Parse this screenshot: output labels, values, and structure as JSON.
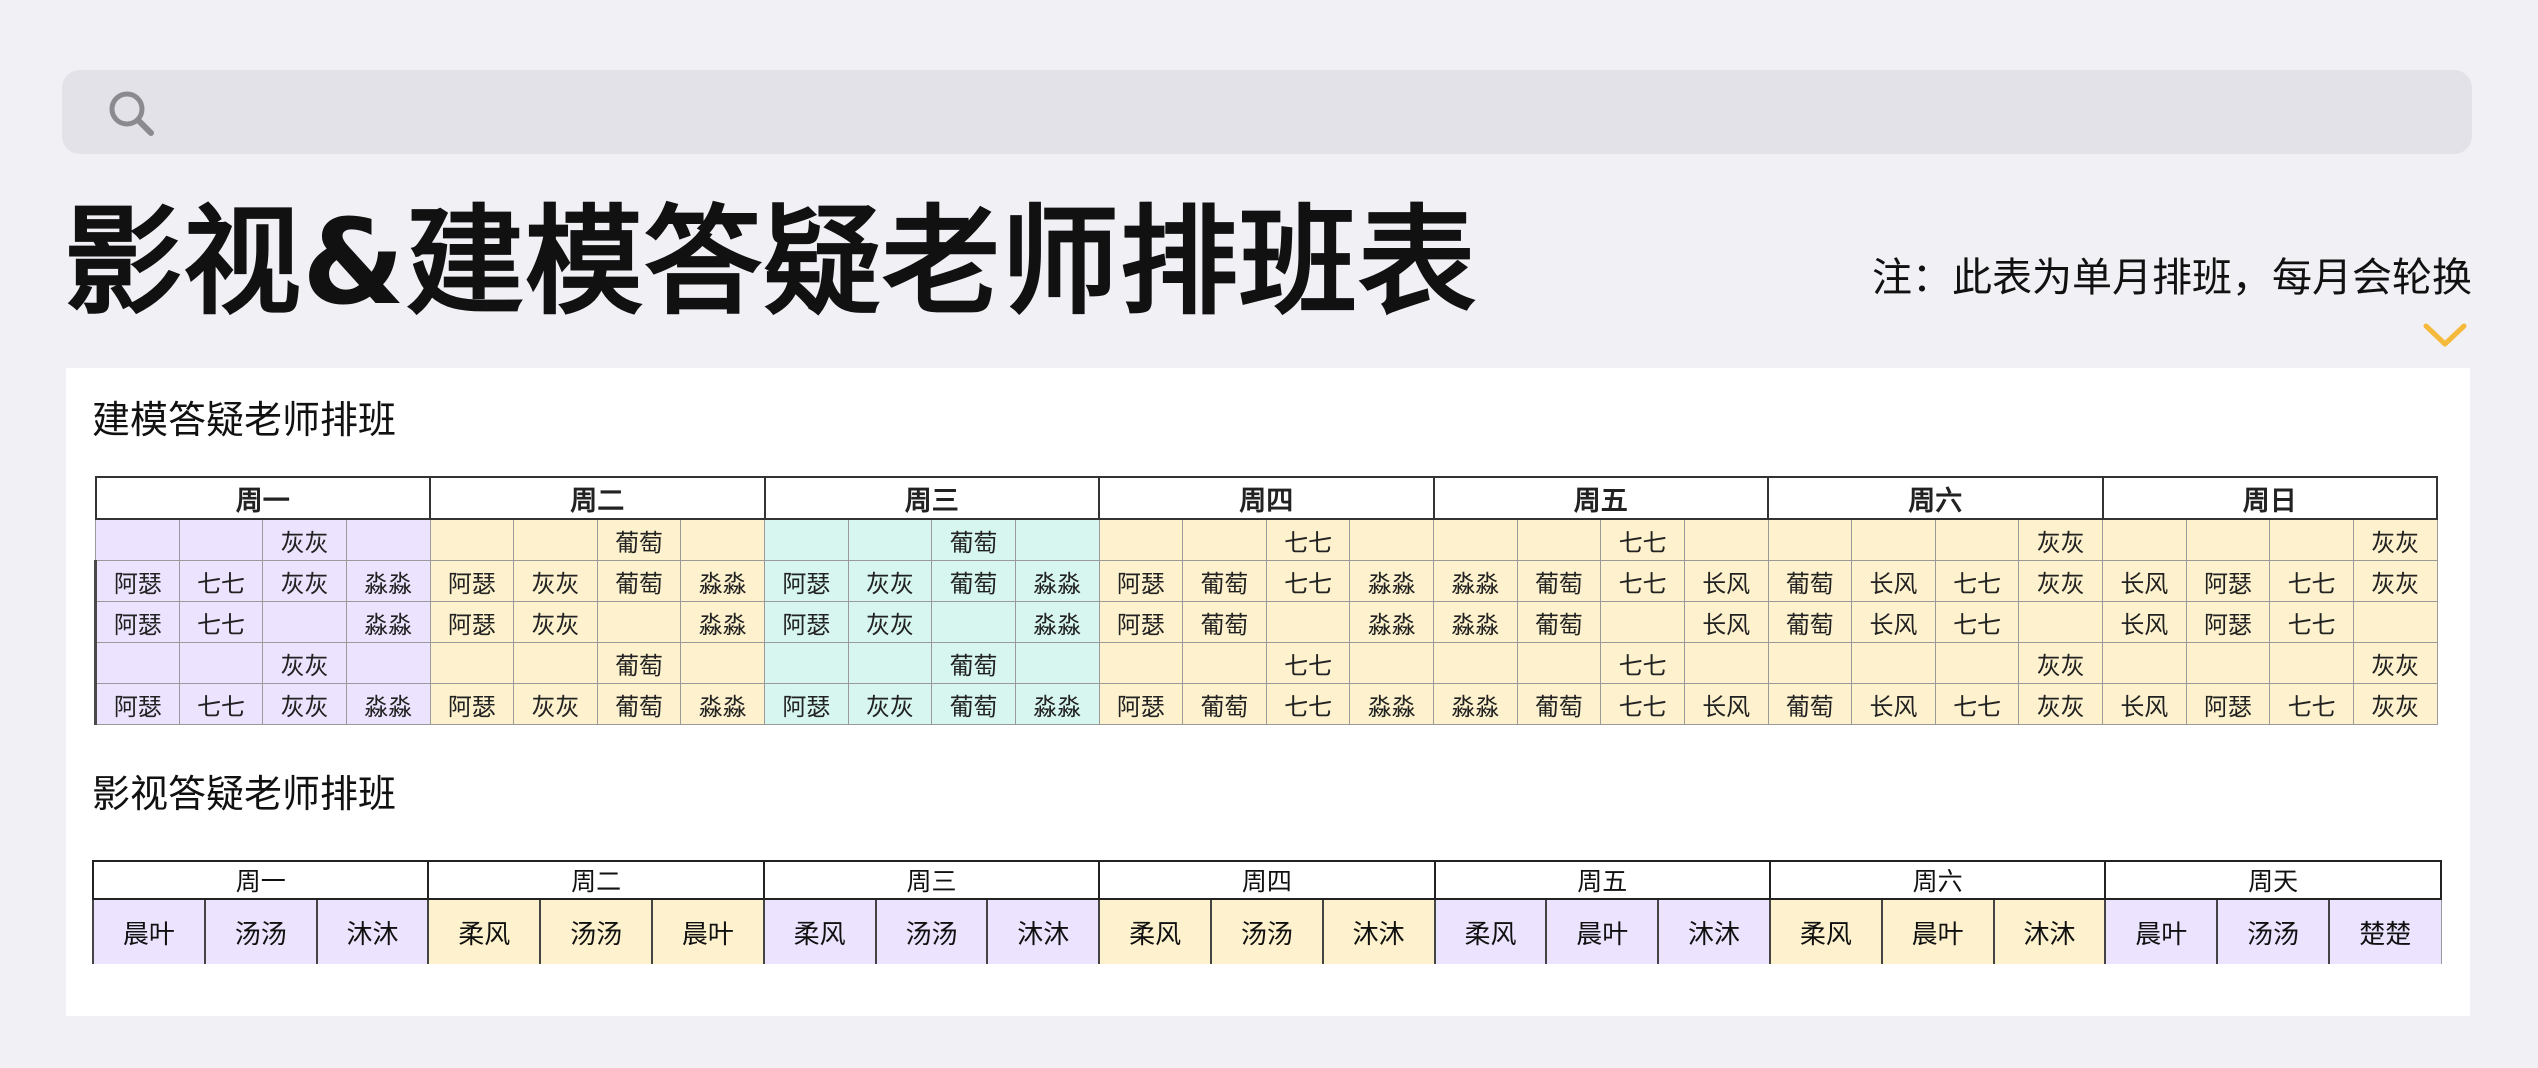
{
  "search": {
    "icon": "search-icon"
  },
  "page": {
    "title": "影视&建模答疑老师排班表",
    "note": "注：此表为单月排班，每月会轮换",
    "note_icon": "chevron-down-icon"
  },
  "colors": {
    "accent": "#f5b93b",
    "purple": "#ece3fe",
    "yellow": "#fdf2cd",
    "cyan": "#d6f6ef",
    "background": "#f1f0f5"
  },
  "modeling": {
    "title": "建模答疑老师排班",
    "days": [
      {
        "name": "周一",
        "color": "purple"
      },
      {
        "name": "周二",
        "color": "yellow"
      },
      {
        "name": "周三",
        "color": "cyan"
      },
      {
        "name": "周四",
        "color": "yellow"
      },
      {
        "name": "周五",
        "color": "yellow"
      },
      {
        "name": "周六",
        "color": "yellow"
      },
      {
        "name": "周日",
        "color": "yellow"
      }
    ],
    "rows": [
      [
        "",
        "",
        "灰灰",
        "",
        "",
        "",
        "葡萄",
        "",
        "",
        "",
        "葡萄",
        "",
        "",
        "",
        "七七",
        "",
        "",
        "",
        "七七",
        "",
        "",
        "",
        "",
        "灰灰",
        "",
        "",
        "",
        "灰灰"
      ],
      [
        "阿瑟",
        "七七",
        "灰灰",
        "淼淼",
        "阿瑟",
        "灰灰",
        "葡萄",
        "淼淼",
        "阿瑟",
        "灰灰",
        "葡萄",
        "淼淼",
        "阿瑟",
        "葡萄",
        "七七",
        "淼淼",
        "淼淼",
        "葡萄",
        "七七",
        "长风",
        "葡萄",
        "长风",
        "七七",
        "灰灰",
        "长风",
        "阿瑟",
        "七七",
        "灰灰"
      ],
      [
        "阿瑟",
        "七七",
        "",
        "淼淼",
        "阿瑟",
        "灰灰",
        "",
        "淼淼",
        "阿瑟",
        "灰灰",
        "",
        "淼淼",
        "阿瑟",
        "葡萄",
        "",
        "淼淼",
        "淼淼",
        "葡萄",
        "",
        "长风",
        "葡萄",
        "长风",
        "七七",
        "",
        "长风",
        "阿瑟",
        "七七",
        ""
      ],
      [
        "",
        "",
        "灰灰",
        "",
        "",
        "",
        "葡萄",
        "",
        "",
        "",
        "葡萄",
        "",
        "",
        "",
        "七七",
        "",
        "",
        "",
        "七七",
        "",
        "",
        "",
        "",
        "灰灰",
        "",
        "",
        "",
        "灰灰"
      ],
      [
        "阿瑟",
        "七七",
        "灰灰",
        "淼淼",
        "阿瑟",
        "灰灰",
        "葡萄",
        "淼淼",
        "阿瑟",
        "灰灰",
        "葡萄",
        "淼淼",
        "阿瑟",
        "葡萄",
        "七七",
        "淼淼",
        "淼淼",
        "葡萄",
        "七七",
        "长风",
        "葡萄",
        "长风",
        "七七",
        "灰灰",
        "长风",
        "阿瑟",
        "七七",
        "灰灰"
      ]
    ]
  },
  "film": {
    "title": "影视答疑老师排班",
    "days": [
      {
        "name": "周一",
        "color": "purple",
        "teachers": [
          "晨叶",
          "汤汤",
          "沐沐"
        ]
      },
      {
        "name": "周二",
        "color": "yellow",
        "teachers": [
          "柔风",
          "汤汤",
          "晨叶"
        ]
      },
      {
        "name": "周三",
        "color": "purple",
        "teachers": [
          "柔风",
          "汤汤",
          "沐沐"
        ]
      },
      {
        "name": "周四",
        "color": "yellow",
        "teachers": [
          "柔风",
          "汤汤",
          "沐沐"
        ]
      },
      {
        "name": "周五",
        "color": "purple",
        "teachers": [
          "柔风",
          "晨叶",
          "沐沐"
        ]
      },
      {
        "name": "周六",
        "color": "yellow",
        "teachers": [
          "柔风",
          "晨叶",
          "沐沐"
        ]
      },
      {
        "name": "周天",
        "color": "purple",
        "teachers": [
          "晨叶",
          "汤汤",
          "楚楚"
        ]
      }
    ]
  }
}
